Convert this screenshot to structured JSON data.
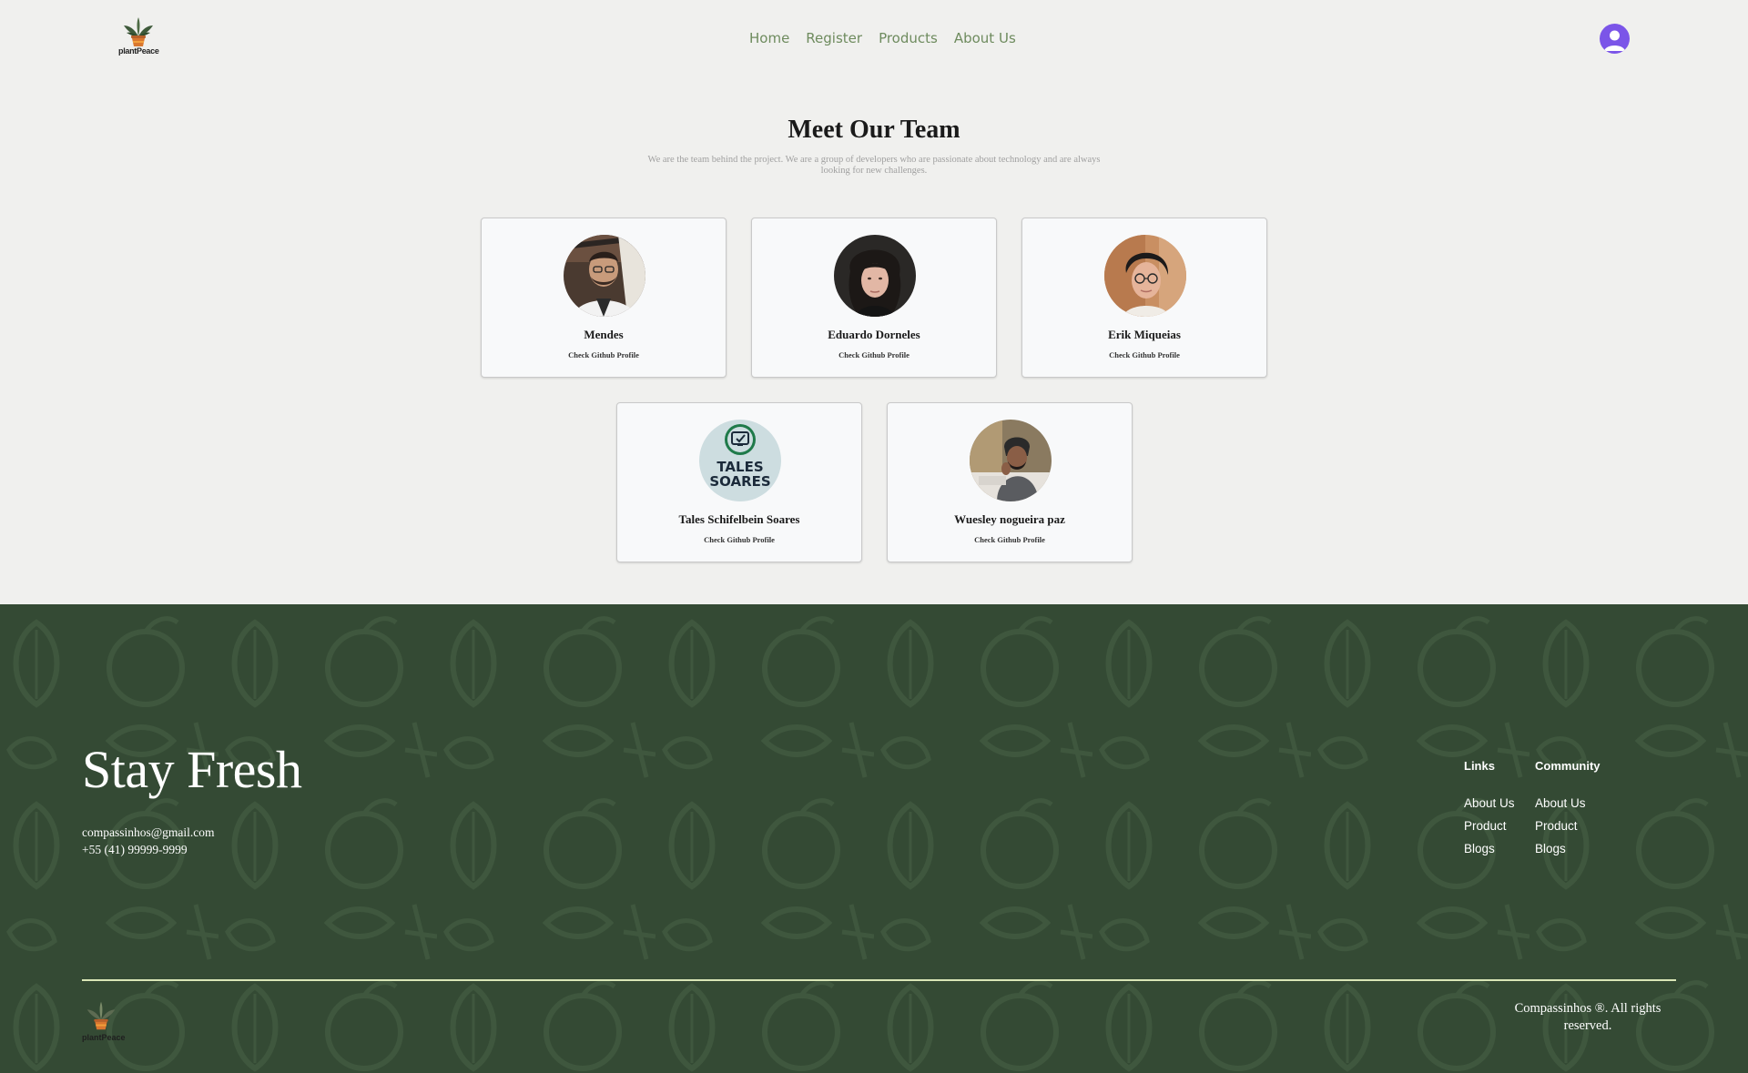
{
  "header": {
    "logo_text": "plantPeace",
    "nav": [
      "Home",
      "Register",
      "Products",
      "About Us"
    ]
  },
  "team": {
    "title": "Meet Our Team",
    "subtitle": "We are the team behind the project. We are a group of developers who are passionate about technology and are always looking for new challenges.",
    "members": [
      {
        "name": "Mendes",
        "link": "Check Github Profile"
      },
      {
        "name": "Eduardo Dorneles",
        "link": "Check Github Profile"
      },
      {
        "name": "Erik Miqueias",
        "link": "Check Github Profile"
      },
      {
        "name": "Tales Schifelbein Soares",
        "link": "Check Github Profile",
        "avatar_text": [
          "TALES",
          "SOARES"
        ]
      },
      {
        "name": "Wuesley nogueira paz",
        "link": "Check Github Profile"
      }
    ]
  },
  "footer": {
    "heading": "Stay Fresh",
    "email": "compassinhos@gmail.com",
    "phone": "+55 (41) 99999-9999",
    "links_title": "Links",
    "links": [
      "About Us",
      "Product",
      "Blogs"
    ],
    "community_title": "Community",
    "community": [
      "About Us",
      "Product",
      "Blogs"
    ],
    "logo_text": "plantPeace",
    "copyright": "Compassinhos ®. All rights reserved."
  },
  "colors": {
    "page_bg": "#f0f0ee",
    "nav_text": "#6e8b5e",
    "avatar_button": "#7b55e8",
    "footer_bg": "#344a34",
    "divider": "#d9e6b6"
  }
}
